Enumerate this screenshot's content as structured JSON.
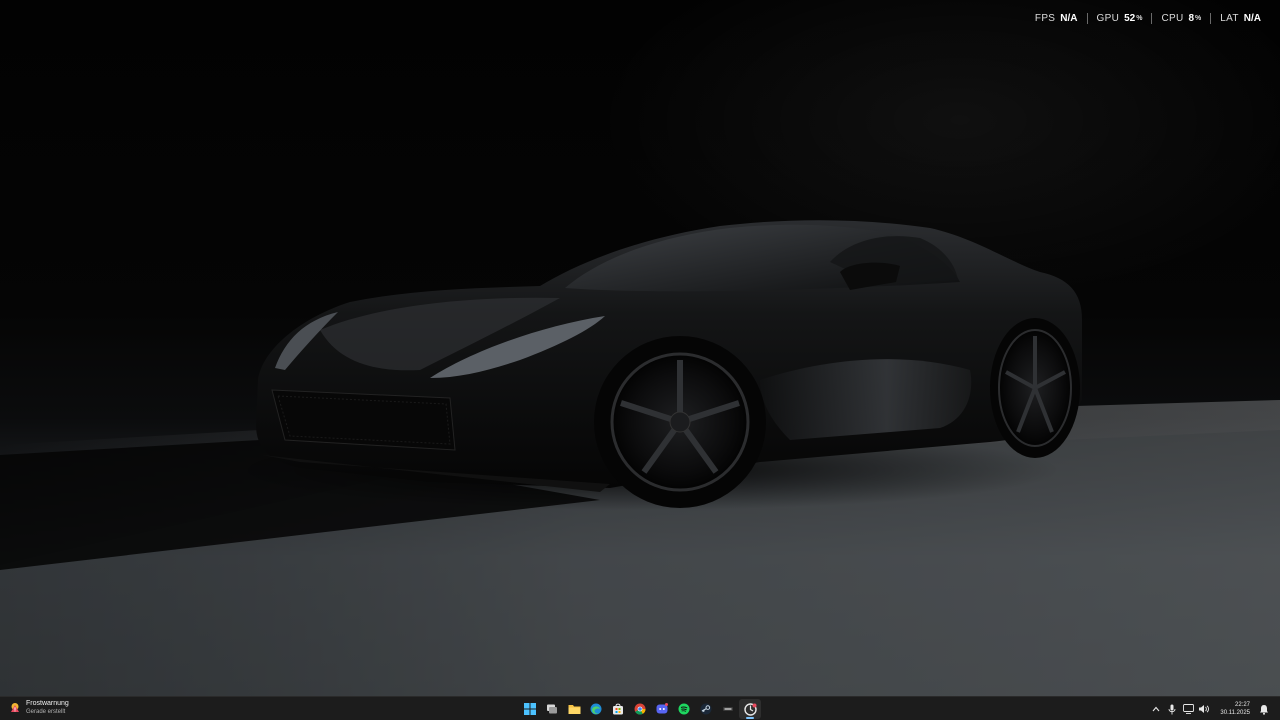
{
  "overlay": {
    "metrics": [
      {
        "label": "FPS",
        "value": "N/A",
        "unit": ""
      },
      {
        "label": "GPU",
        "value": "52",
        "unit": "%"
      },
      {
        "label": "CPU",
        "value": "8",
        "unit": "%"
      },
      {
        "label": "LAT",
        "value": "N/A",
        "unit": ""
      }
    ]
  },
  "notification": {
    "title": "Frostwarnung",
    "subtitle": "Gerade erstellt",
    "icon": "weather-warning-icon"
  },
  "taskbar": {
    "pinned_apps": [
      {
        "name": "start",
        "icon": "windows-start-icon"
      },
      {
        "name": "task-view",
        "icon": "task-view-icon"
      },
      {
        "name": "file-explorer",
        "icon": "folder-icon"
      },
      {
        "name": "edge",
        "icon": "edge-icon"
      },
      {
        "name": "store",
        "icon": "store-icon"
      },
      {
        "name": "chrome",
        "icon": "chrome-icon"
      },
      {
        "name": "discord",
        "icon": "discord-icon"
      },
      {
        "name": "spotify",
        "icon": "spotify-icon"
      },
      {
        "name": "steam",
        "icon": "steam-icon"
      },
      {
        "name": "app",
        "icon": "app-icon"
      },
      {
        "name": "active-app",
        "icon": "active-app-icon"
      }
    ],
    "tray": {
      "icons": [
        "chevron-up-icon",
        "microphone-icon",
        "network-icon",
        "volume-icon"
      ],
      "time": "22:27",
      "date": "30.11.2025"
    }
  },
  "colors": {
    "taskbar_bg": "#1c1c1c",
    "accent": "#7cc4ff",
    "warning": "#f2b632"
  }
}
